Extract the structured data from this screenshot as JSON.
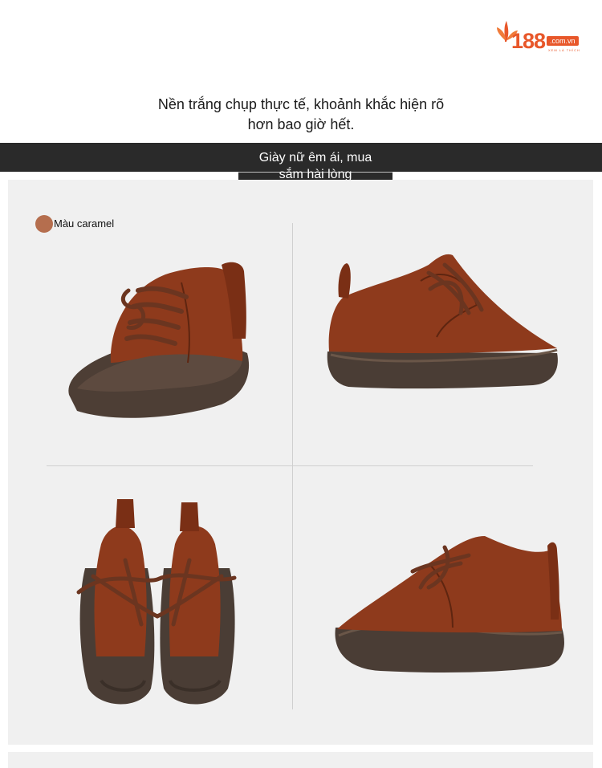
{
  "logo": {
    "number": "188",
    "domain": ".com.vn",
    "tagline": "XEM LÀ THÍCH"
  },
  "headline": {
    "line1": "Nền trắng chụp thực tế, khoảnh khắc hiện rõ",
    "line2": "hơn bao giờ hết."
  },
  "banner": {
    "line1": "Giày nữ êm ái, mua",
    "line2": "sắm hài lòng"
  },
  "color_option": {
    "label": "Màu caramel",
    "swatch_color": "#b56e4e"
  },
  "colors": {
    "accent": "#e8572a",
    "banner_bg": "#2a2a2a",
    "panel_bg": "#f0f0f0",
    "leather": "#8e3a1c",
    "sole": "#4a3d35"
  }
}
